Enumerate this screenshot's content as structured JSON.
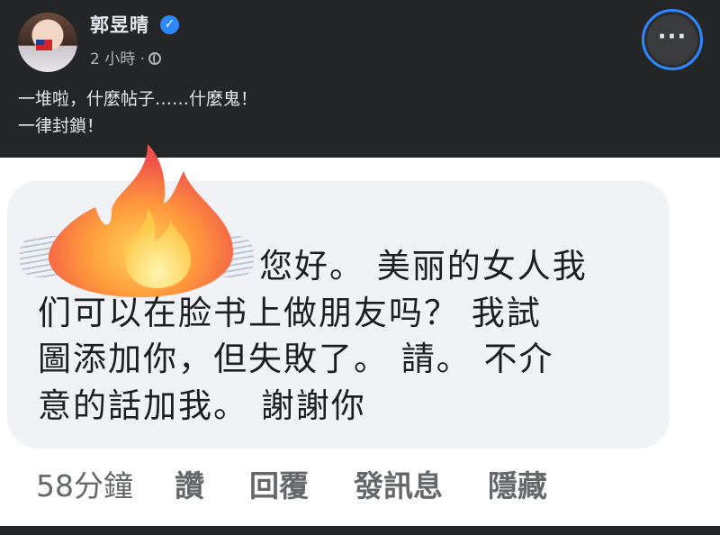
{
  "post": {
    "author": "郭昱晴",
    "time": "2 小時 ·",
    "text_lines": [
      "一堆啦，什麼帖子……什麼鬼！",
      "一律封鎖！"
    ],
    "more_label": "···"
  },
  "screenshot": {
    "message_lines": [
      "您好。 美丽的女人我",
      "们可以在脸书上做朋友吗？ 我試",
      "圖添加你，但失敗了。 請。 不介",
      "意的話加我。 謝謝你"
    ],
    "time": "58分鐘",
    "actions": [
      "讚",
      "回覆",
      "發訊息",
      "隱藏"
    ]
  },
  "colors": {
    "background": "#242526",
    "accent": "#2d88ff",
    "bubble": "#f0f2f5",
    "text_light": "#e4e6eb"
  },
  "icons": [
    "verified-badge-icon",
    "globe-icon",
    "more-options-icon",
    "fire-emoji-icon"
  ]
}
